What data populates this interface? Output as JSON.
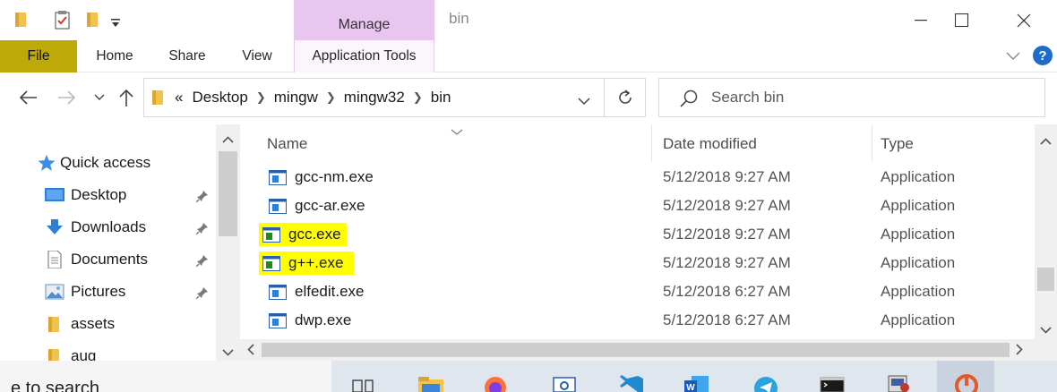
{
  "titlebar": {
    "manage_label": "Manage",
    "window_title": "bin"
  },
  "ribbon": {
    "tabs": {
      "file": "File",
      "home": "Home",
      "share": "Share",
      "view": "View",
      "app_tools": "Application Tools"
    }
  },
  "address": {
    "overflow": "«",
    "crumbs": [
      "Desktop",
      "mingw",
      "mingw32",
      "bin"
    ]
  },
  "search": {
    "placeholder": "Search bin"
  },
  "nav": {
    "quick_access": "Quick access",
    "items": [
      {
        "label": "Desktop",
        "icon": "desktop-icon",
        "pinned": true
      },
      {
        "label": "Downloads",
        "icon": "downloads-icon",
        "pinned": true
      },
      {
        "label": "Documents",
        "icon": "documents-icon",
        "pinned": true
      },
      {
        "label": "Pictures",
        "icon": "pictures-icon",
        "pinned": true
      },
      {
        "label": "assets",
        "icon": "folder-icon",
        "pinned": false
      },
      {
        "label": "aug",
        "icon": "folder-icon",
        "pinned": false
      }
    ]
  },
  "columns": {
    "name": "Name",
    "date": "Date modified",
    "type": "Type"
  },
  "files": [
    {
      "name": "gcc-nm.exe",
      "date": "5/12/2018 9:27 AM",
      "type": "Application",
      "highlight": false
    },
    {
      "name": "gcc-ar.exe",
      "date": "5/12/2018 9:27 AM",
      "type": "Application",
      "highlight": false
    },
    {
      "name": "gcc.exe",
      "date": "5/12/2018 9:27 AM",
      "type": "Application",
      "highlight": true
    },
    {
      "name": "g++.exe",
      "date": "5/12/2018 9:27 AM",
      "type": "Application",
      "highlight": true
    },
    {
      "name": "elfedit.exe",
      "date": "5/12/2018 6:27 AM",
      "type": "Application",
      "highlight": false
    },
    {
      "name": "dwp.exe",
      "date": "5/12/2018 6:27 AM",
      "type": "Application",
      "highlight": false
    }
  ],
  "taskbar": {
    "search_text": "e to search"
  },
  "colors": {
    "file_tab": "#bda908",
    "manage_tab": "#e9c6f0",
    "highlight": "#ffff00",
    "help": "#1e6bc8"
  }
}
